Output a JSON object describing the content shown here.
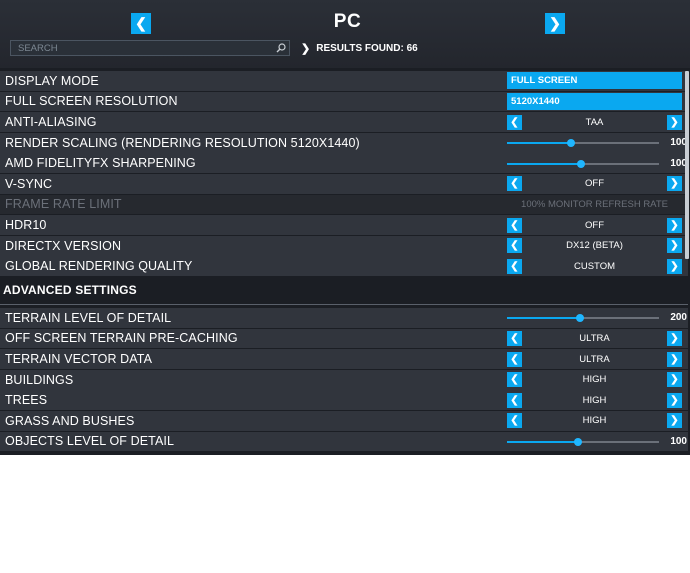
{
  "header": {
    "title": "PC",
    "prev_icon": "chevron-left-icon",
    "next_icon": "chevron-right-icon"
  },
  "search": {
    "placeholder": "SEARCH",
    "value": ""
  },
  "results": {
    "label": "RESULTS FOUND: 66"
  },
  "colors": {
    "accent": "#0aa8f0",
    "row_bg": "#31353d",
    "panel_bg": "#1b1e24"
  },
  "rows": [
    {
      "label": "DISPLAY MODE",
      "type": "select",
      "value": "FULL SCREEN"
    },
    {
      "label": "FULL SCREEN RESOLUTION",
      "type": "select",
      "value": "5120X1440"
    },
    {
      "label": "ANTI-ALIASING",
      "type": "stepper",
      "value": "TAA"
    },
    {
      "label": "RENDER SCALING (RENDERING RESOLUTION 5120X1440)",
      "type": "slider",
      "value": "100",
      "fraction": 0.42
    },
    {
      "label": "AMD FIDELITYFX SHARPENING",
      "type": "slider",
      "value": "100",
      "fraction": 0.49
    },
    {
      "label": "V-SYNC",
      "type": "stepper",
      "value": "OFF"
    },
    {
      "label": "FRAME RATE LIMIT",
      "type": "static",
      "value": "100% MONITOR REFRESH RATE",
      "disabled": true
    },
    {
      "label": "HDR10",
      "type": "stepper",
      "value": "OFF"
    },
    {
      "label": "DIRECTX VERSION",
      "type": "stepper",
      "value": "DX12 (BETA)"
    },
    {
      "label": "GLOBAL RENDERING QUALITY",
      "type": "stepper",
      "value": "CUSTOM"
    }
  ],
  "advanced": {
    "heading": "ADVANCED SETTINGS",
    "rows": [
      {
        "label": "TERRAIN LEVEL OF DETAIL",
        "type": "slider",
        "value": "200",
        "fraction": 0.48
      },
      {
        "label": "OFF SCREEN TERRAIN PRE-CACHING",
        "type": "stepper",
        "value": "ULTRA"
      },
      {
        "label": "TERRAIN VECTOR DATA",
        "type": "stepper",
        "value": "ULTRA"
      },
      {
        "label": "BUILDINGS",
        "type": "stepper",
        "value": "HIGH"
      },
      {
        "label": "TREES",
        "type": "stepper",
        "value": "HIGH"
      },
      {
        "label": "GRASS AND BUSHES",
        "type": "stepper",
        "value": "HIGH"
      },
      {
        "label": "OBJECTS LEVEL OF DETAIL",
        "type": "slider",
        "value": "100",
        "fraction": 0.47
      }
    ]
  }
}
